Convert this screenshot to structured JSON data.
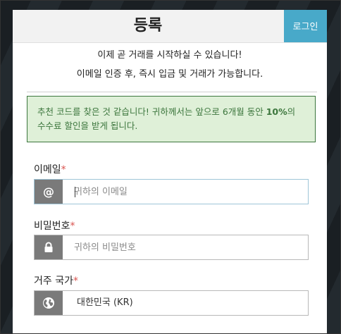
{
  "header": {
    "title": "등록",
    "login_label": "로그인"
  },
  "intro": {
    "line1": "이제 곧 거래를 시작하실 수 있습니다!",
    "line2": "이메일 인증 후, 즉시 입금 및 거래가 가능합니다."
  },
  "promo": {
    "text_part1": "추천 코드를 찾은 것 같습니다! 귀하께서는 앞으로 6개월 동안 ",
    "bold": "10%",
    "text_part2": "의 수수료 할인을 받게 됩니다."
  },
  "form": {
    "email": {
      "label": "이메일",
      "required_mark": "*",
      "placeholder": "귀하의 이메일",
      "value": "",
      "icon": "at-icon"
    },
    "password": {
      "label": "비밀번호",
      "required_mark": "*",
      "placeholder": "귀하의 비밀번호",
      "value": "",
      "icon": "lock-icon"
    },
    "country": {
      "label": "거주 국가",
      "required_mark": "*",
      "value": "대한민국 (KR)",
      "icon": "globe-icon"
    }
  },
  "colors": {
    "accent": "#48a9c9",
    "promo_bg": "#dff0d8",
    "promo_text": "#3c763d",
    "addon_bg": "#7a7a7a",
    "required": "#d9534f"
  }
}
